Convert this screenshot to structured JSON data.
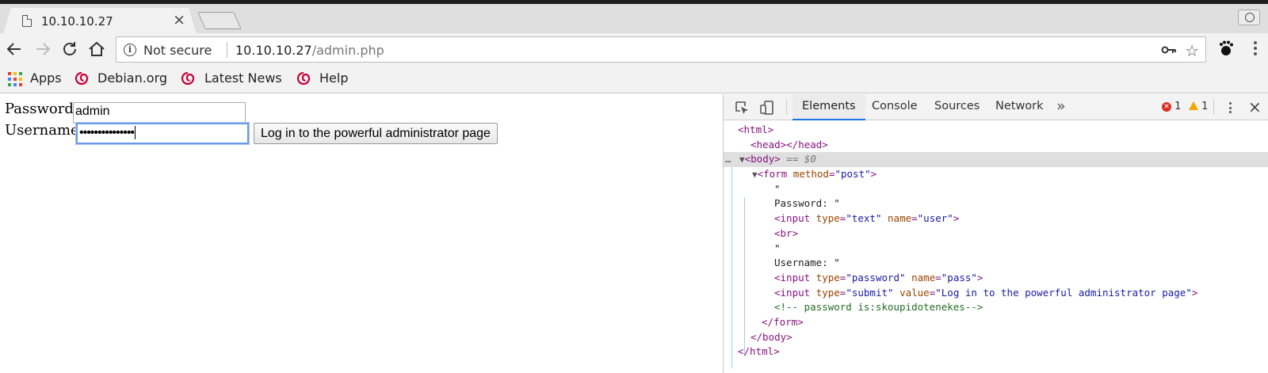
{
  "browser": {
    "tab_title": "10.10.10.27",
    "tab_close": "×",
    "omnibox": {
      "security_label": "Not secure",
      "url_host": "10.10.10.27",
      "url_path": "/admin.php"
    },
    "bookmarks": [
      {
        "label": "Apps",
        "icon": "apps-grid-icon"
      },
      {
        "label": "Debian.org",
        "icon": "debian-swirl-icon"
      },
      {
        "label": "Latest News",
        "icon": "debian-swirl-icon"
      },
      {
        "label": "Help",
        "icon": "debian-swirl-icon"
      }
    ]
  },
  "page": {
    "password_label": "Password:",
    "password_field_value": "admin",
    "username_label": "Username:",
    "username_field_value": "•••••••••••••••",
    "submit_label": "Log in to the powerful administrator page"
  },
  "devtools": {
    "tabs": [
      "Elements",
      "Console",
      "Sources",
      "Network"
    ],
    "more": "»",
    "error_count": "1",
    "warning_count": "1",
    "close": "×",
    "dom": {
      "l1": "<html>",
      "l2_open": "<head>",
      "l2_close": "</head>",
      "l3_tag": "<body>",
      "l3_ref": " == $0",
      "l4_tag": "<form",
      "l4_attr": "method",
      "l4_val": "\"post\"",
      "l5": "\"",
      "l6": "Password: \"",
      "l7_attr1": "type",
      "l7_val1": "\"text\"",
      "l7_attr2": "name",
      "l7_val2": "\"user\"",
      "l8": "<br>",
      "l9": "\"",
      "l10": "Username: \"",
      "l11_attr1": "type",
      "l11_val1": "\"password\"",
      "l11_attr2": "name",
      "l11_val2": "\"pass\"",
      "l12_attr1": "type",
      "l12_val1": "\"submit\"",
      "l12_attr2": "value",
      "l12_val2": "\"Log in to the powerful administrator page\"",
      "l13": "<!-- password is:skoupidotenekes-->",
      "l14": "</form>",
      "l15": "</body>",
      "l16": "</html>"
    }
  }
}
